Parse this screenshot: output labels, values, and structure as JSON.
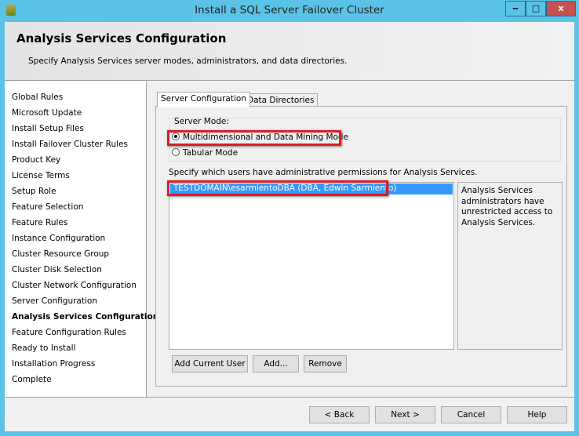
{
  "window": {
    "title": "Install a SQL Server Failover Cluster",
    "minimize": "‒",
    "maximize": "□",
    "close": "x"
  },
  "header": {
    "title": "Analysis Services Configuration",
    "subtitle": "Specify Analysis Services server modes, administrators, and data directories."
  },
  "sidebar": {
    "items": [
      {
        "label": "Global Rules"
      },
      {
        "label": "Microsoft Update"
      },
      {
        "label": "Install Setup Files"
      },
      {
        "label": "Install Failover Cluster Rules"
      },
      {
        "label": "Product Key"
      },
      {
        "label": "License Terms"
      },
      {
        "label": "Setup Role"
      },
      {
        "label": "Feature Selection"
      },
      {
        "label": "Feature Rules"
      },
      {
        "label": "Instance Configuration"
      },
      {
        "label": "Cluster Resource Group"
      },
      {
        "label": "Cluster Disk Selection"
      },
      {
        "label": "Cluster Network Configuration"
      },
      {
        "label": "Server Configuration"
      },
      {
        "label": "Analysis Services Configuration",
        "active": true
      },
      {
        "label": "Feature Configuration Rules"
      },
      {
        "label": "Ready to Install"
      },
      {
        "label": "Installation Progress"
      },
      {
        "label": "Complete"
      }
    ]
  },
  "tabs": [
    {
      "label": "Server Configuration",
      "active": true
    },
    {
      "label": "Data Directories"
    }
  ],
  "server_mode": {
    "label": "Server Mode:",
    "options": [
      {
        "label": "Multidimensional and Data Mining Mode",
        "selected": true
      },
      {
        "label": "Tabular Mode",
        "selected": false
      }
    ]
  },
  "admins": {
    "label": "Specify which users have administrative permissions for Analysis Services.",
    "users": [
      "TESTDOMAIN\\esarmientoDBA (DBA, Edwin Sarmiento)"
    ],
    "description": "Analysis Services administrators have unrestricted access to Analysis Services."
  },
  "buttons": {
    "add_current_user": "Add Current User",
    "add": "Add...",
    "remove": "Remove",
    "back": "< Back",
    "next": "Next >",
    "cancel": "Cancel",
    "help": "Help"
  }
}
